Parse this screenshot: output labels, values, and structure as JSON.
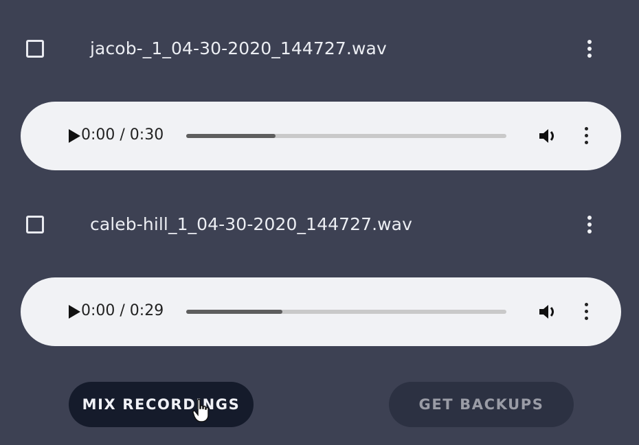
{
  "recordings": [
    {
      "file_name": "jacob-_1_04-30-2020_144727.wav",
      "player": {
        "time": "0:00 / 0:30",
        "progress": 0.28
      }
    },
    {
      "file_name": "caleb-hill_1_04-30-2020_144727.wav",
      "player": {
        "time": "0:00 / 0:29",
        "progress": 0.3
      }
    }
  ],
  "actions": {
    "mix_label": "MIX RECORDINGS",
    "backup_label": "GET BACKUPS"
  },
  "icons": {
    "checkbox": "checkbox-unchecked-icon",
    "more": "more-vert-icon",
    "play": "play-icon",
    "volume": "volume-icon",
    "cursor": "hand-pointer-cursor"
  },
  "colors": {
    "background": "#3d4153",
    "primary_button": "#151b2b",
    "secondary_button": "#2c3142",
    "player_bg": "#f1f2f5"
  }
}
